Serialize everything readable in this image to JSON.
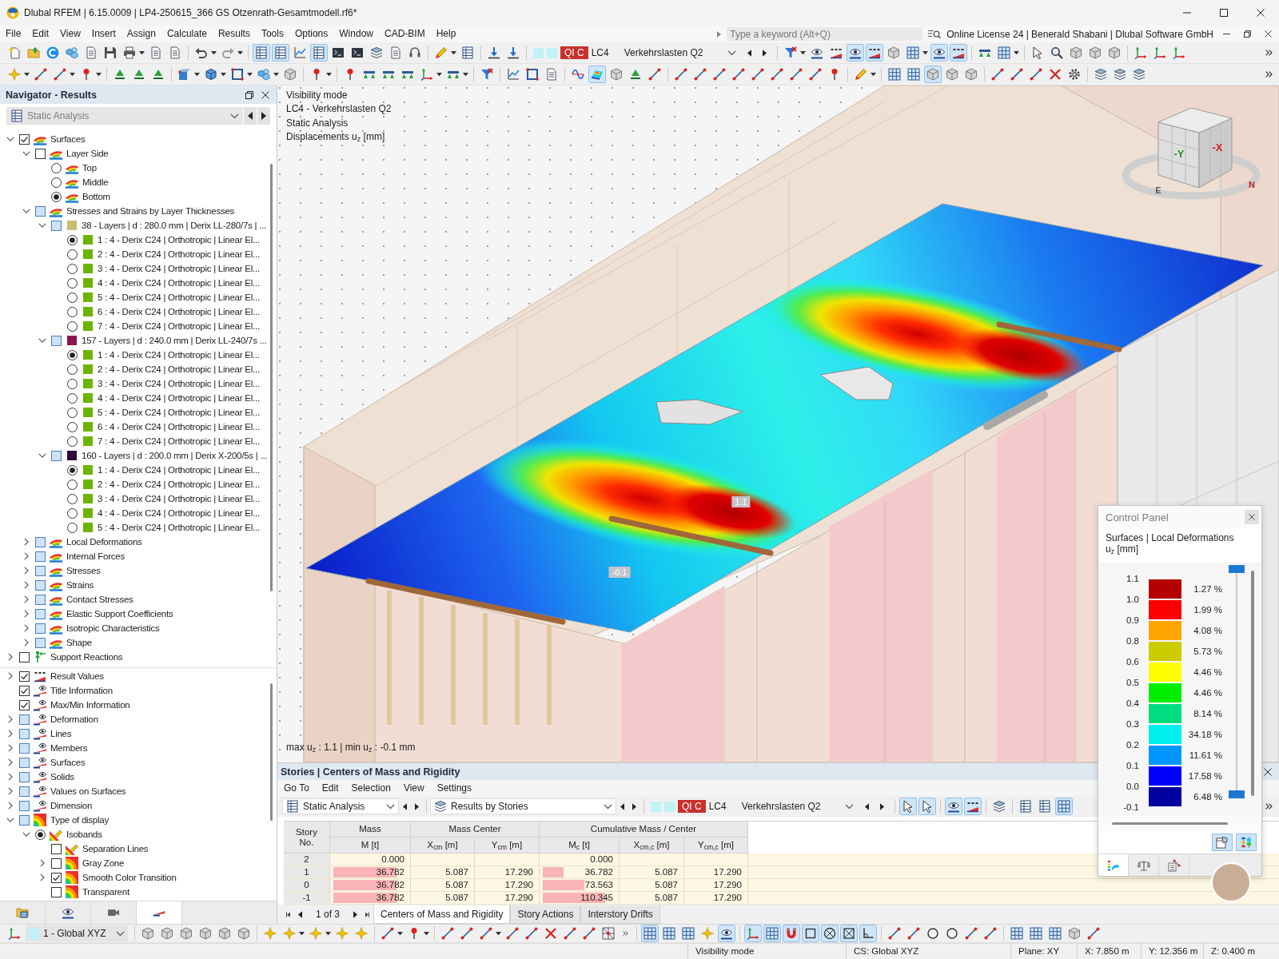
{
  "window": {
    "title": "Dlubal RFEM | 6.15.0009 | LP4-250615_366 GS Otzenrath-Gesamtmodell.rf6*"
  },
  "menu": [
    "File",
    "Edit",
    "View",
    "Insert",
    "Assign",
    "Calculate",
    "Results",
    "Tools",
    "Options",
    "Window",
    "CAD-BIM",
    "Help"
  ],
  "search": {
    "placeholder": "Type a keyword (Alt+Q)"
  },
  "license": "Online License 24 | Benerald Shabani | Dlubal Software GmbH",
  "toolbar": {
    "row_1_left": [
      {
        "on": false
      },
      {
        "on": false
      },
      {
        "on": false
      },
      {
        "on": false
      },
      {
        "on": false
      },
      {
        "on": false
      },
      {
        "on": false
      },
      {
        "on": false
      },
      {
        "on": false
      },
      {
        "on": false
      },
      {
        "on": false
      },
      {
        "on": true
      },
      {
        "on": true
      },
      {
        "on": false
      },
      {
        "on": true
      },
      {
        "on": false
      },
      {
        "on": false
      },
      {
        "on": false
      },
      {
        "on": false
      },
      {
        "on": false
      },
      {
        "on": false
      },
      {
        "on": false
      },
      {
        "on": false
      },
      {
        "on": false
      }
    ],
    "load_case": {
      "badge": "QI C",
      "number": "LC4",
      "name": "Verkehrslasten Q2"
    },
    "row_1_right": [
      {
        "on": false
      },
      {
        "on": false
      },
      {
        "on": false
      },
      {
        "on": true
      },
      {
        "on": true
      },
      {
        "on": false
      },
      {
        "on": false
      },
      {
        "on": true
      },
      {
        "on": true
      },
      {
        "on": false
      },
      {
        "on": false
      },
      {
        "on": false
      },
      {
        "on": false
      },
      {
        "on": false
      },
      {
        "on": false
      },
      {
        "on": false
      },
      {
        "on": false
      },
      {
        "on": false
      },
      {
        "on": false
      }
    ],
    "row_2": [
      {
        "on": false
      },
      {
        "on": false
      },
      {
        "on": false
      },
      {
        "on": false
      },
      {
        "on": false
      },
      {
        "on": false
      },
      {
        "on": false
      },
      {
        "on": false
      },
      {
        "on": false
      },
      {
        "on": false
      },
      {
        "on": false
      },
      {
        "on": false
      },
      {
        "on": false
      },
      {
        "on": false
      },
      {
        "on": false
      },
      {
        "on": false
      },
      {
        "on": false
      },
      {
        "on": false
      },
      {
        "on": false
      },
      {
        "on": false
      },
      {
        "on": false
      },
      {
        "on": false
      },
      {
        "on": false
      },
      {
        "on": false
      },
      {
        "on": true
      },
      {
        "on": false
      },
      {
        "on": false
      },
      {
        "on": false
      },
      {
        "on": false
      },
      {
        "on": false
      },
      {
        "on": false
      },
      {
        "on": false
      },
      {
        "on": false
      },
      {
        "on": false
      },
      {
        "on": false
      },
      {
        "on": false
      },
      {
        "on": false
      },
      {
        "on": false
      },
      {
        "on": false
      },
      {
        "on": false
      },
      {
        "on": true
      },
      {
        "on": false
      },
      {
        "on": false
      },
      {
        "on": false
      },
      {
        "on": false
      },
      {
        "on": false
      },
      {
        "on": false
      },
      {
        "on": false
      },
      {
        "on": false
      },
      {
        "on": false
      },
      {
        "on": false
      }
    ]
  },
  "navigator": {
    "title": "Navigator - Results",
    "analysis": "Static Analysis",
    "results_tree": [
      {
        "kind": "result",
        "label": "Surfaces",
        "checked": true,
        "mixed": false,
        "expanded": true,
        "children": [
          {
            "kind": "result",
            "label": "Layer Side",
            "checked": false,
            "mixed": false,
            "expanded": true,
            "children": [
              {
                "kind": "side",
                "label": "Top",
                "checked": false
              },
              {
                "kind": "side",
                "label": "Middle",
                "checked": false
              },
              {
                "kind": "side",
                "label": "Bottom",
                "checked": true
              }
            ]
          },
          {
            "kind": "result",
            "label": "Stresses and Strains by Layer Thicknesses",
            "checked": false,
            "mixed": true,
            "expanded": true,
            "children": [
              {
                "kind": "layer_set",
                "label": "38 - Layers | d : 280.0 mm | Derix LL-280/7s | ...",
                "color": "#c8c070",
                "checked": false,
                "mixed": true,
                "expanded": true,
                "children": [
                  {
                    "kind": "layer",
                    "label": "1 : 4 - Derix C24 | Orthotropic | Linear El...",
                    "color": "#6cb400",
                    "checked": true
                  },
                  {
                    "kind": "layer",
                    "label": "2 : 4 - Derix C24 | Orthotropic | Linear El...",
                    "color": "#6cb400",
                    "checked": false
                  },
                  {
                    "kind": "layer",
                    "label": "3 : 4 - Derix C24 | Orthotropic | Linear El...",
                    "color": "#6cb400",
                    "checked": false
                  },
                  {
                    "kind": "layer",
                    "label": "4 : 4 - Derix C24 | Orthotropic | Linear El...",
                    "color": "#6cb400",
                    "checked": false
                  },
                  {
                    "kind": "layer",
                    "label": "5 : 4 - Derix C24 | Orthotropic | Linear El...",
                    "color": "#6cb400",
                    "checked": false
                  },
                  {
                    "kind": "layer",
                    "label": "6 : 4 - Derix C24 | Orthotropic | Linear El...",
                    "color": "#6cb400",
                    "checked": false
                  },
                  {
                    "kind": "layer",
                    "label": "7 : 4 - Derix C24 | Orthotropic | Linear El...",
                    "color": "#6cb400",
                    "checked": false
                  }
                ]
              },
              {
                "kind": "layer_set",
                "label": "157 - Layers | d : 240.0 mm | Derix LL-240/7s ...",
                "color": "#8c1450",
                "checked": false,
                "mixed": true,
                "expanded": true,
                "children": [
                  {
                    "kind": "layer",
                    "label": "1 : 4 - Derix C24 | Orthotropic | Linear El...",
                    "color": "#6cb400",
                    "checked": true
                  },
                  {
                    "kind": "layer",
                    "label": "2 : 4 - Derix C24 | Orthotropic | Linear El...",
                    "color": "#6cb400",
                    "checked": false
                  },
                  {
                    "kind": "layer",
                    "label": "3 : 4 - Derix C24 | Orthotropic | Linear El...",
                    "color": "#6cb400",
                    "checked": false
                  },
                  {
                    "kind": "layer",
                    "label": "4 : 4 - Derix C24 | Orthotropic | Linear El...",
                    "color": "#6cb400",
                    "checked": false
                  },
                  {
                    "kind": "layer",
                    "label": "5 : 4 - Derix C24 | Orthotropic | Linear El...",
                    "color": "#6cb400",
                    "checked": false
                  },
                  {
                    "kind": "layer",
                    "label": "6 : 4 - Derix C24 | Orthotropic | Linear El...",
                    "color": "#6cb400",
                    "checked": false
                  },
                  {
                    "kind": "layer",
                    "label": "7 : 4 - Derix C24 | Orthotropic | Linear El...",
                    "color": "#6cb400",
                    "checked": false
                  }
                ]
              },
              {
                "kind": "layer_set",
                "label": "160 - Layers | d : 200.0 mm | Derix X-200/5s | ...",
                "color": "#2c0a3c",
                "checked": false,
                "mixed": true,
                "expanded": true,
                "children": [
                  {
                    "kind": "layer",
                    "label": "1 : 4 - Derix C24 | Orthotropic | Linear El...",
                    "color": "#6cb400",
                    "checked": true
                  },
                  {
                    "kind": "layer",
                    "label": "2 : 4 - Derix C24 | Orthotropic | Linear El...",
                    "color": "#6cb400",
                    "checked": false
                  },
                  {
                    "kind": "layer",
                    "label": "3 : 4 - Derix C24 | Orthotropic | Linear El...",
                    "color": "#6cb400",
                    "checked": false
                  },
                  {
                    "kind": "layer",
                    "label": "4 : 4 - Derix C24 | Orthotropic | Linear El...",
                    "color": "#6cb400",
                    "checked": false
                  },
                  {
                    "kind": "layer",
                    "label": "5 : 4 - Derix C24 | Orthotropic | Linear El...",
                    "color": "#6cb400",
                    "checked": false
                  }
                ]
              }
            ]
          },
          {
            "kind": "result",
            "label": "Local Deformations",
            "checked": false,
            "mixed": true,
            "expanded": false
          },
          {
            "kind": "result",
            "label": "Internal Forces",
            "checked": false,
            "mixed": true,
            "expanded": false
          },
          {
            "kind": "result",
            "label": "Stresses",
            "checked": false,
            "mixed": true,
            "expanded": false
          },
          {
            "kind": "result",
            "label": "Strains",
            "checked": false,
            "mixed": true,
            "expanded": false
          },
          {
            "kind": "result",
            "label": "Contact Stresses",
            "checked": false,
            "mixed": true,
            "expanded": false
          },
          {
            "kind": "result",
            "label": "Elastic Support Coefficients",
            "checked": false,
            "mixed": true,
            "expanded": false
          },
          {
            "kind": "result",
            "label": "Isotropic Characteristics",
            "checked": false,
            "mixed": true,
            "expanded": false
          },
          {
            "kind": "result",
            "label": "Shape",
            "checked": false,
            "mixed": true,
            "expanded": false
          }
        ]
      },
      {
        "kind": "support",
        "label": "Support Reactions",
        "checked": false,
        "mixed": false,
        "expanded": false
      }
    ],
    "display_tree": [
      {
        "kind": "values",
        "label": "Result Values",
        "checked": true,
        "mixed": false,
        "expanded": false
      },
      {
        "kind": "display",
        "label": "Title Information",
        "checked": true,
        "mixed": false
      },
      {
        "kind": "display",
        "label": "Max/Min Information",
        "checked": true,
        "mixed": false
      },
      {
        "kind": "display",
        "label": "Deformation",
        "checked": false,
        "mixed": true,
        "expanded": false
      },
      {
        "kind": "display",
        "label": "Lines",
        "checked": false,
        "mixed": true,
        "expanded": false
      },
      {
        "kind": "display",
        "label": "Members",
        "checked": false,
        "mixed": true,
        "expanded": false
      },
      {
        "kind": "display",
        "label": "Surfaces",
        "checked": false,
        "mixed": true,
        "expanded": false
      },
      {
        "kind": "display",
        "label": "Solids",
        "checked": false,
        "mixed": true,
        "expanded": false
      },
      {
        "kind": "display",
        "label": "Values on Surfaces",
        "checked": false,
        "mixed": true,
        "expanded": false
      },
      {
        "kind": "display",
        "label": "Dimension",
        "checked": false,
        "mixed": true,
        "expanded": false
      },
      {
        "kind": "display_type",
        "label": "Type of display",
        "checked": false,
        "mixed": true,
        "expanded": true,
        "children": [
          {
            "kind": "mode",
            "label": "Isobands",
            "checked": true,
            "expanded": true,
            "children": [
              {
                "kind": "lines_style",
                "label": "Separation Lines",
                "checked": false,
                "mixed": false
              },
              {
                "kind": "style",
                "label": "Gray Zone",
                "checked": false,
                "mixed": false,
                "expanded": false
              },
              {
                "kind": "style",
                "label": "Smooth Color Transition",
                "checked": true,
                "mixed": false,
                "expanded": false
              },
              {
                "kind": "style",
                "label": "Transparent",
                "checked": false,
                "mixed": false
              }
            ]
          }
        ]
      }
    ],
    "tabs": [
      {
        "selected": false
      },
      {
        "selected": false
      },
      {
        "selected": false
      },
      {
        "selected": true
      }
    ]
  },
  "viewport": {
    "info": [
      "Visibility mode",
      "LC4 - Verkehrslasten Q2",
      "Static Analysis",
      "Displacements u$_{z}$ [mm]"
    ],
    "value_labels": [
      "1.1",
      "-0.1"
    ],
    "view_cube": [
      "-Y",
      "-X",
      "E",
      "N"
    ],
    "extremes": "max u$_{z}$ : 1.1 | min u$_{z}$ : -0.1 mm"
  },
  "table_panel": {
    "title": "Stories | Centers of Mass and Rigidity",
    "menu": [
      "Go To",
      "Edit",
      "Selection",
      "View",
      "Settings"
    ],
    "analysis": "Static Analysis",
    "result_group": "Results by Stories",
    "load_case": {
      "badge": "QI C",
      "number": "LC4",
      "name": "Verkehrslasten Q2"
    },
    "toolbar": [
      {
        "on": true
      },
      {
        "on": true
      },
      {
        "on": true
      },
      {
        "on": true
      },
      {
        "on": false
      },
      {
        "on": false
      },
      {
        "on": false
      },
      {
        "on": true
      }
    ],
    "story_column": "Story No.",
    "column_groups": [
      {
        "label": "Mass",
        "columns": [
          "M [t]"
        ]
      },
      {
        "label": "Mass Center",
        "columns": [
          "X$_{cm}$ [m]",
          "Y$_{cm}$ [m]"
        ]
      },
      {
        "label": "Cumulative Mass / Center",
        "columns": [
          "M$_{c}$ [t]",
          "X$_{cm,c}$ [m]",
          "Y$_{cm,c}$ [m]"
        ]
      }
    ],
    "rows": [
      {
        "story": "2",
        "mass": {
          "text": "0.000",
          "level": 0
        },
        "cumulative_mass": {
          "text": "0.000",
          "level": 0
        }
      },
      {
        "story": "1",
        "mass": {
          "text": "36.782",
          "level": 0.87
        },
        "x_cm": "5.087",
        "y_cm": "17.290",
        "cumulative_mass": {
          "text": "36.782",
          "level": 0.29
        },
        "x_cm_c": "5.087",
        "y_cm_c": "17.290"
      },
      {
        "story": "0",
        "mass": {
          "text": "36.782",
          "level": 0.87
        },
        "x_cm": "5.087",
        "y_cm": "17.290",
        "cumulative_mass": {
          "text": "73.563",
          "level": 0.58
        },
        "x_cm_c": "5.087",
        "y_cm_c": "17.290"
      },
      {
        "story": "-1",
        "mass": {
          "text": "36.782",
          "level": 0.87
        },
        "x_cm": "5.087",
        "y_cm": "17.290",
        "cumulative_mass": {
          "text": "110.345",
          "level": 0.87
        },
        "x_cm_c": "5.087",
        "y_cm_c": "17.290"
      }
    ],
    "pager": "1 of 3",
    "tabs": [
      {
        "label": "Centers of Mass and Rigidity",
        "selected": true
      },
      {
        "label": "Story Actions",
        "selected": false
      },
      {
        "label": "Interstory Drifts",
        "selected": false
      }
    ]
  },
  "control_panel": {
    "title": "Control Panel",
    "heading": "Surfaces | Local Deformations",
    "quantity": "u$_{z}$ [mm]",
    "ticks": [
      "1.1",
      "1.0",
      "0.9",
      "0.8",
      "0.6",
      "0.5",
      "0.4",
      "0.3",
      "0.2",
      "0.1",
      "0.0",
      "-0.1"
    ],
    "bands": [
      {
        "color": "#b40000",
        "share": "1.27 %"
      },
      {
        "color": "#ff0000",
        "share": "1.99 %"
      },
      {
        "color": "#ffa500",
        "share": "4.08 %"
      },
      {
        "color": "#cccc00",
        "share": "5.73 %"
      },
      {
        "color": "#ffff00",
        "share": "4.46 %"
      },
      {
        "color": "#00ee00",
        "share": "4.46 %"
      },
      {
        "color": "#00dd80",
        "share": "8.14 %"
      },
      {
        "color": "#00f0f0",
        "share": "34.18 %"
      },
      {
        "color": "#0096ff",
        "share": "11.61 %"
      },
      {
        "color": "#0000ff",
        "share": "17.58 %"
      },
      {
        "color": "#00009e",
        "share": "6.48 %"
      }
    ],
    "range_top": {
      "level": 1
    },
    "range_bottom": {
      "level": 0
    },
    "buttons": [
      {
        "on": true
      },
      {
        "on": true
      }
    ],
    "tabs": [
      {
        "selected": true
      },
      {
        "selected": false
      },
      {
        "selected": false
      }
    ]
  },
  "bottom_toolbar": {
    "coordinate_system": "1 - Global XYZ",
    "buttons": [
      {
        "on": false
      },
      {
        "on": false
      },
      {
        "on": false
      },
      {
        "on": false
      },
      {
        "on": false
      },
      {
        "on": false
      },
      {
        "on": false
      },
      {
        "on": false
      },
      {
        "on": false
      },
      {
        "on": false
      },
      {
        "on": false
      },
      {
        "on": false
      },
      {
        "on": false
      },
      {
        "on": false
      },
      {
        "on": false
      },
      {
        "on": false
      },
      {
        "on": false
      },
      {
        "on": false
      },
      {
        "on": false
      },
      {
        "on": false
      },
      {
        "on": false
      },
      {
        "on": false
      },
      {
        "on": true
      },
      {
        "on": false
      },
      {
        "on": false
      },
      {
        "on": false
      },
      {
        "on": true
      },
      {
        "on": true
      },
      {
        "on": true
      },
      {
        "on": true
      },
      {
        "on": true
      },
      {
        "on": true
      },
      {
        "on": true
      },
      {
        "on": true
      },
      {
        "on": false
      },
      {
        "on": false
      },
      {
        "on": false
      },
      {
        "on": false
      },
      {
        "on": false
      },
      {
        "on": false
      },
      {
        "on": false
      },
      {
        "on": false
      },
      {
        "on": false
      },
      {
        "on": false
      },
      {
        "on": false
      }
    ]
  },
  "status_bar": [
    "Visibility mode",
    "CS: Global XYZ",
    "Plane: XY",
    "X: 7.850 m",
    "Y: 12.356 m",
    "Z: 0.400 m"
  ]
}
